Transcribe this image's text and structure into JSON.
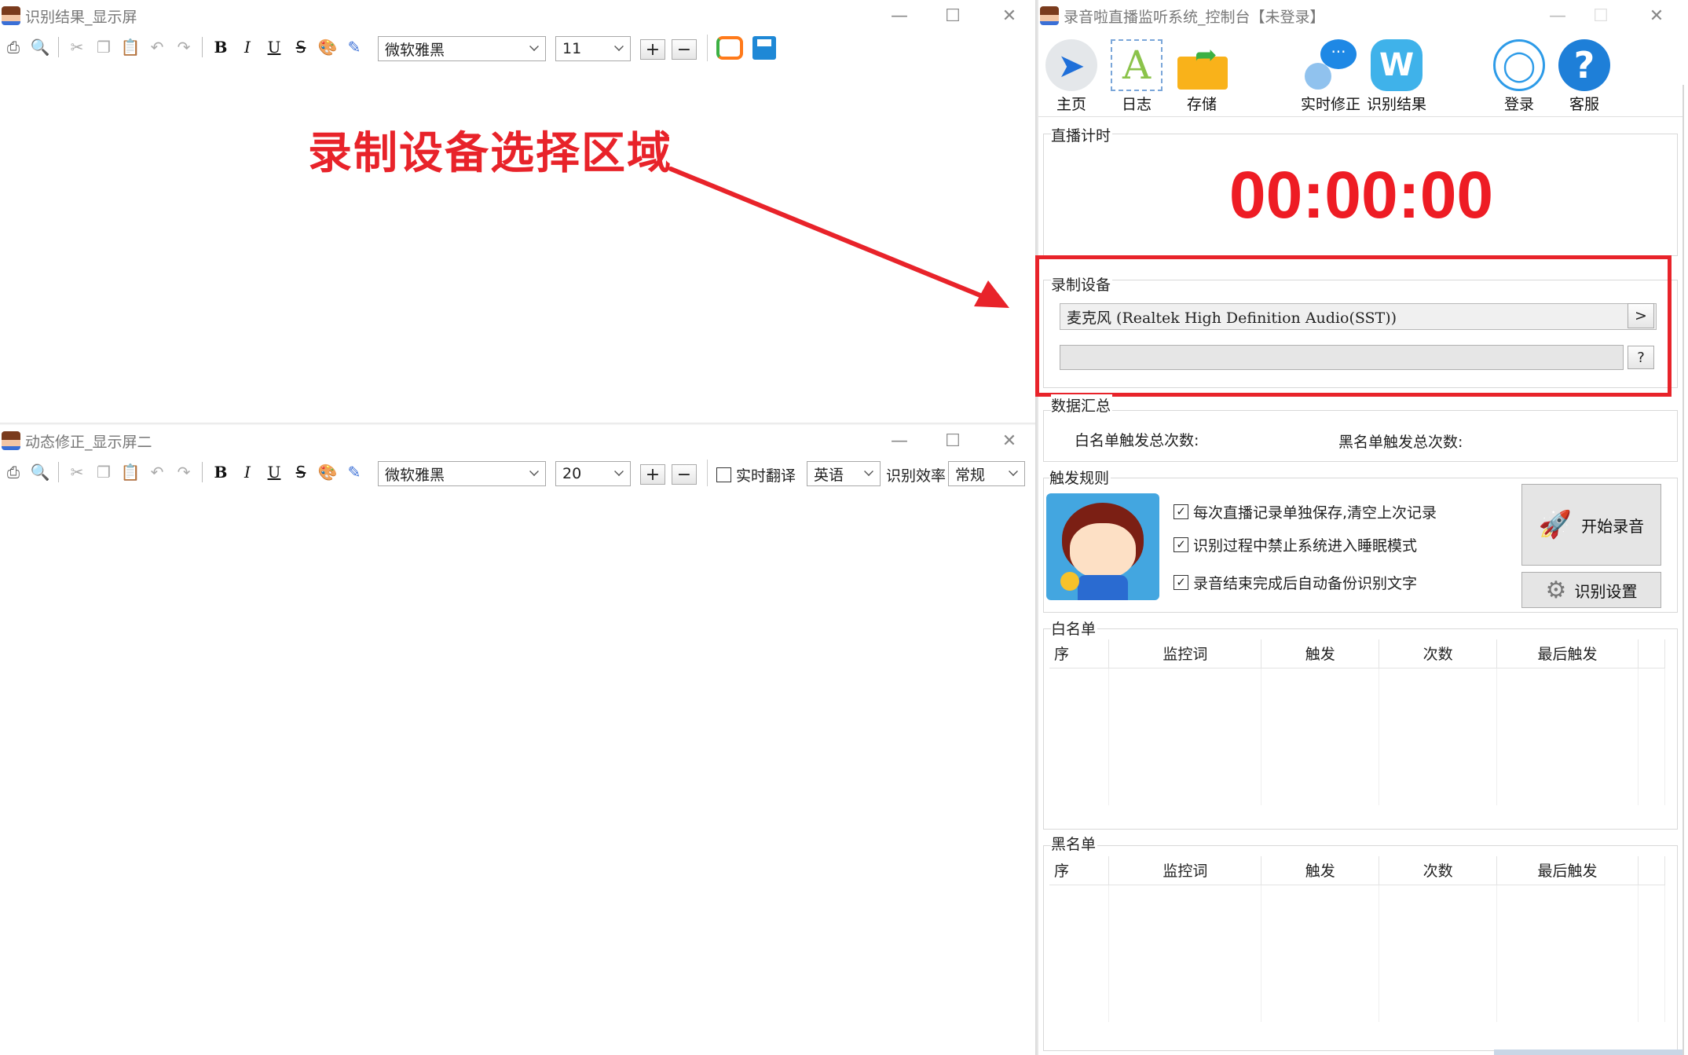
{
  "window1": {
    "title": "识别结果_显示屏",
    "font": "微软雅黑",
    "size": "11",
    "plus": "+",
    "minus": "−"
  },
  "window2": {
    "title": "动态修正_显示屏二",
    "font": "微软雅黑",
    "size": "20",
    "plus": "+",
    "minus": "−",
    "translate_label": "实时翻译",
    "language": "英语",
    "efficiency_label": "识别效率",
    "efficiency": "常规"
  },
  "annotation": {
    "text": "录制设备选择区域",
    "color": "#e8232a"
  },
  "control": {
    "title": "录音啦直播监听系统_控制台【未登录】",
    "nav": [
      {
        "label": "主页",
        "icon": "navigate-arrow-icon"
      },
      {
        "label": "日志",
        "icon": "letter-a-icon"
      },
      {
        "label": "存储",
        "icon": "folder-icon"
      },
      {
        "label": "实时修正",
        "icon": "chat-bubble-icon"
      },
      {
        "label": "识别结果",
        "icon": "letter-w-icon"
      },
      {
        "label": "登录",
        "icon": "user-icon"
      },
      {
        "label": "客服",
        "icon": "help-icon"
      }
    ],
    "timer_label": "直播计时",
    "timer": "00:00:00",
    "device_label": "录制设备",
    "device": "麦克风 (Realtek High Definition Audio(SST))",
    "device_next": ">",
    "level_help": "?",
    "summary_label": "数据汇总",
    "white_total": "白名单触发总次数:",
    "black_total": "黑名单触发总次数:",
    "rules_label": "触发规则",
    "rules": [
      "每次直播记录单独保存,清空上次记录",
      "识别过程中禁止系统进入睡眠模式",
      "录音结束完成后自动备份识别文字"
    ],
    "start_button": "开始录音",
    "settings_button": "识别设置",
    "whitelist_label": "白名单",
    "blacklist_label": "黑名单",
    "columns": [
      "序",
      "监控词",
      "触发",
      "次数",
      "最后触发"
    ],
    "timer_color": "#ee1c24",
    "accent": "#2d9be8"
  }
}
